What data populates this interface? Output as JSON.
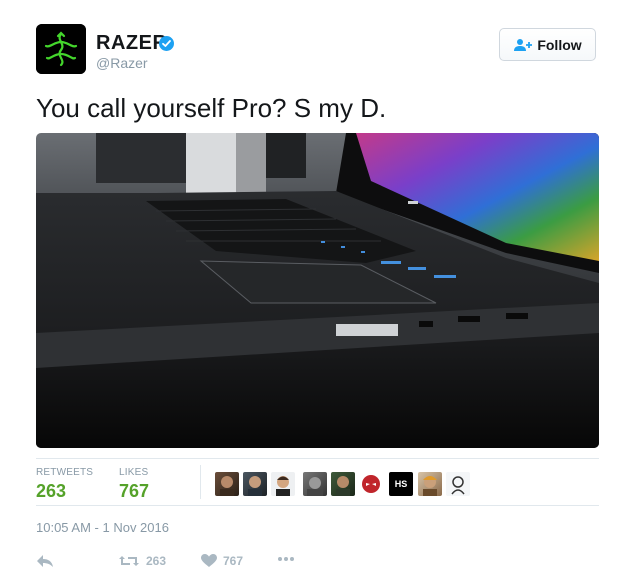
{
  "user": {
    "display_name": "RAZER",
    "handle": "@Razer",
    "verified": true,
    "avatar_icon": "razer-snake-logo",
    "brand_color": "#44d62c"
  },
  "follow_button": {
    "label": "Follow",
    "icon": "follow-user-icon"
  },
  "tweet": {
    "text": "You call yourself Pro? S my D."
  },
  "media": {
    "description_icon": "laptop-photo"
  },
  "stats": {
    "retweets_label": "RETWEETS",
    "retweets_value": "263",
    "likes_label": "LIKES",
    "likes_value": "767",
    "accent_color": "#55a22a"
  },
  "liked_by_badge": "HS",
  "timestamp": "10:05 AM - 1 Nov 2016",
  "actions": {
    "reply_icon": "reply-icon",
    "retweet_icon": "retweet-icon",
    "retweet_count": "263",
    "like_icon": "heart-icon",
    "like_count": "767",
    "more_icon": "more-icon"
  }
}
